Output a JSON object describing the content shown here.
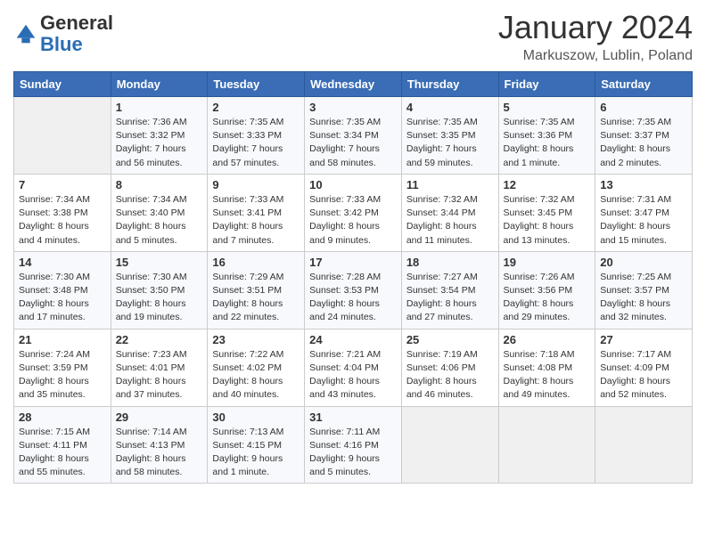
{
  "header": {
    "logo_general": "General",
    "logo_blue": "Blue",
    "calendar_title": "January 2024",
    "calendar_subtitle": "Markuszow, Lublin, Poland"
  },
  "weekdays": [
    "Sunday",
    "Monday",
    "Tuesday",
    "Wednesday",
    "Thursday",
    "Friday",
    "Saturday"
  ],
  "weeks": [
    [
      {
        "day": "",
        "detail": ""
      },
      {
        "day": "1",
        "detail": "Sunrise: 7:36 AM\nSunset: 3:32 PM\nDaylight: 7 hours\nand 56 minutes."
      },
      {
        "day": "2",
        "detail": "Sunrise: 7:35 AM\nSunset: 3:33 PM\nDaylight: 7 hours\nand 57 minutes."
      },
      {
        "day": "3",
        "detail": "Sunrise: 7:35 AM\nSunset: 3:34 PM\nDaylight: 7 hours\nand 58 minutes."
      },
      {
        "day": "4",
        "detail": "Sunrise: 7:35 AM\nSunset: 3:35 PM\nDaylight: 7 hours\nand 59 minutes."
      },
      {
        "day": "5",
        "detail": "Sunrise: 7:35 AM\nSunset: 3:36 PM\nDaylight: 8 hours\nand 1 minute."
      },
      {
        "day": "6",
        "detail": "Sunrise: 7:35 AM\nSunset: 3:37 PM\nDaylight: 8 hours\nand 2 minutes."
      }
    ],
    [
      {
        "day": "7",
        "detail": "Sunrise: 7:34 AM\nSunset: 3:38 PM\nDaylight: 8 hours\nand 4 minutes."
      },
      {
        "day": "8",
        "detail": "Sunrise: 7:34 AM\nSunset: 3:40 PM\nDaylight: 8 hours\nand 5 minutes."
      },
      {
        "day": "9",
        "detail": "Sunrise: 7:33 AM\nSunset: 3:41 PM\nDaylight: 8 hours\nand 7 minutes."
      },
      {
        "day": "10",
        "detail": "Sunrise: 7:33 AM\nSunset: 3:42 PM\nDaylight: 8 hours\nand 9 minutes."
      },
      {
        "day": "11",
        "detail": "Sunrise: 7:32 AM\nSunset: 3:44 PM\nDaylight: 8 hours\nand 11 minutes."
      },
      {
        "day": "12",
        "detail": "Sunrise: 7:32 AM\nSunset: 3:45 PM\nDaylight: 8 hours\nand 13 minutes."
      },
      {
        "day": "13",
        "detail": "Sunrise: 7:31 AM\nSunset: 3:47 PM\nDaylight: 8 hours\nand 15 minutes."
      }
    ],
    [
      {
        "day": "14",
        "detail": "Sunrise: 7:30 AM\nSunset: 3:48 PM\nDaylight: 8 hours\nand 17 minutes."
      },
      {
        "day": "15",
        "detail": "Sunrise: 7:30 AM\nSunset: 3:50 PM\nDaylight: 8 hours\nand 19 minutes."
      },
      {
        "day": "16",
        "detail": "Sunrise: 7:29 AM\nSunset: 3:51 PM\nDaylight: 8 hours\nand 22 minutes."
      },
      {
        "day": "17",
        "detail": "Sunrise: 7:28 AM\nSunset: 3:53 PM\nDaylight: 8 hours\nand 24 minutes."
      },
      {
        "day": "18",
        "detail": "Sunrise: 7:27 AM\nSunset: 3:54 PM\nDaylight: 8 hours\nand 27 minutes."
      },
      {
        "day": "19",
        "detail": "Sunrise: 7:26 AM\nSunset: 3:56 PM\nDaylight: 8 hours\nand 29 minutes."
      },
      {
        "day": "20",
        "detail": "Sunrise: 7:25 AM\nSunset: 3:57 PM\nDaylight: 8 hours\nand 32 minutes."
      }
    ],
    [
      {
        "day": "21",
        "detail": "Sunrise: 7:24 AM\nSunset: 3:59 PM\nDaylight: 8 hours\nand 35 minutes."
      },
      {
        "day": "22",
        "detail": "Sunrise: 7:23 AM\nSunset: 4:01 PM\nDaylight: 8 hours\nand 37 minutes."
      },
      {
        "day": "23",
        "detail": "Sunrise: 7:22 AM\nSunset: 4:02 PM\nDaylight: 8 hours\nand 40 minutes."
      },
      {
        "day": "24",
        "detail": "Sunrise: 7:21 AM\nSunset: 4:04 PM\nDaylight: 8 hours\nand 43 minutes."
      },
      {
        "day": "25",
        "detail": "Sunrise: 7:19 AM\nSunset: 4:06 PM\nDaylight: 8 hours\nand 46 minutes."
      },
      {
        "day": "26",
        "detail": "Sunrise: 7:18 AM\nSunset: 4:08 PM\nDaylight: 8 hours\nand 49 minutes."
      },
      {
        "day": "27",
        "detail": "Sunrise: 7:17 AM\nSunset: 4:09 PM\nDaylight: 8 hours\nand 52 minutes."
      }
    ],
    [
      {
        "day": "28",
        "detail": "Sunrise: 7:15 AM\nSunset: 4:11 PM\nDaylight: 8 hours\nand 55 minutes."
      },
      {
        "day": "29",
        "detail": "Sunrise: 7:14 AM\nSunset: 4:13 PM\nDaylight: 8 hours\nand 58 minutes."
      },
      {
        "day": "30",
        "detail": "Sunrise: 7:13 AM\nSunset: 4:15 PM\nDaylight: 9 hours\nand 1 minute."
      },
      {
        "day": "31",
        "detail": "Sunrise: 7:11 AM\nSunset: 4:16 PM\nDaylight: 9 hours\nand 5 minutes."
      },
      {
        "day": "",
        "detail": ""
      },
      {
        "day": "",
        "detail": ""
      },
      {
        "day": "",
        "detail": ""
      }
    ]
  ]
}
